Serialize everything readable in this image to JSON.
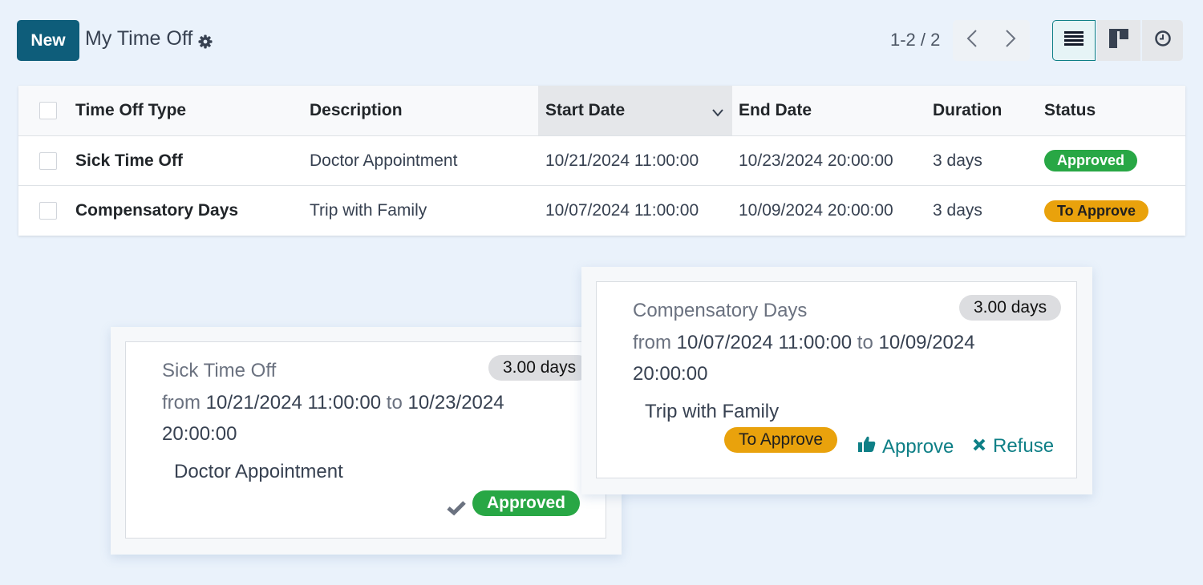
{
  "control_panel": {
    "new_button": "New",
    "title": "My Time Off",
    "settings_icon": "gear-icon",
    "pager": "1-2 / 2",
    "prev_icon": "chevron-left-icon",
    "next_icon": "chevron-right-icon",
    "views": [
      {
        "name": "list",
        "icon": "list-icon",
        "active": true
      },
      {
        "name": "kanban",
        "icon": "kanban-icon",
        "active": false
      },
      {
        "name": "activity",
        "icon": "clock-icon",
        "active": false
      }
    ]
  },
  "table": {
    "columns": [
      "Time Off Type",
      "Description",
      "Start Date",
      "End Date",
      "Duration",
      "Status"
    ],
    "sorted_column": "Start Date",
    "rows": [
      {
        "type": "Sick Time Off",
        "description": "Doctor Appointment",
        "start": "10/21/2024 11:00:00",
        "end": "10/23/2024 20:00:00",
        "duration": "3 days",
        "status": "Approved"
      },
      {
        "type": "Compensatory Days",
        "description": "Trip with Family",
        "start": "10/07/2024 11:00:00",
        "end": "10/09/2024 20:00:00",
        "duration": "3 days",
        "status": "To Approve"
      }
    ]
  },
  "cards": [
    {
      "type": "Sick Time Off",
      "from_label": "from",
      "start": "10/21/2024 11:00:00",
      "to_label": "to",
      "end_date": "10/23/2024",
      "end_time": "20:00:00",
      "days": "3.00 days",
      "description": "Doctor Appointment",
      "status": "Approved"
    },
    {
      "type": "Compensatory Days",
      "from_label": "from",
      "start": "10/07/2024 11:00:00",
      "to_label": "to",
      "end_date": "10/09/2024",
      "end_time": "20:00:00",
      "days": "3.00 days",
      "description": "Trip with Family",
      "status": "To Approve",
      "approve_label": "Approve",
      "refuse_label": "Refuse"
    }
  ],
  "colors": {
    "primary": "#0e5d7a",
    "accent": "#0e7f86",
    "approved": "#28a745",
    "to_approve": "#e9a20c"
  }
}
